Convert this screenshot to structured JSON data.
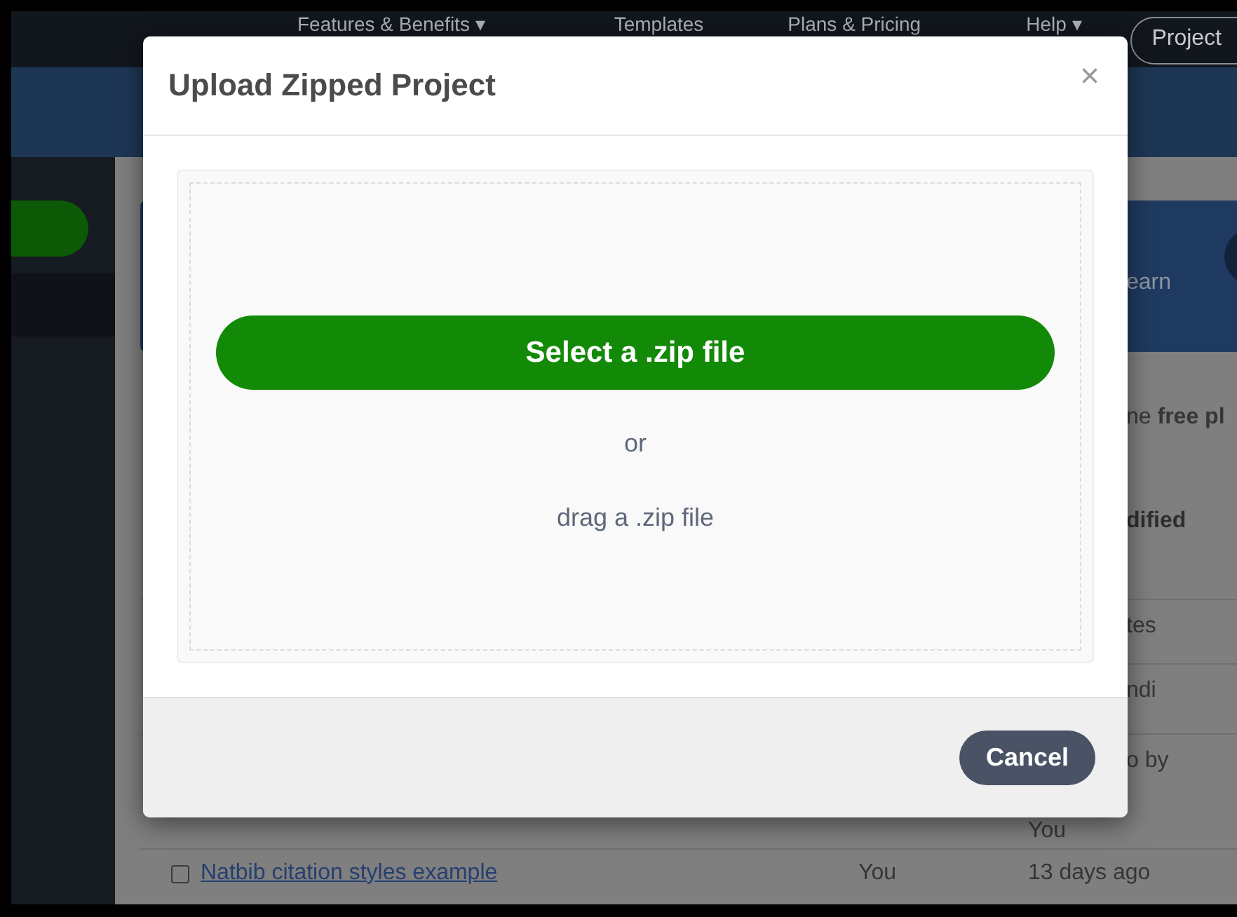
{
  "background_page": {
    "nav": {
      "items": [
        {
          "label": "Features & Benefits ▾"
        },
        {
          "label": "Templates"
        },
        {
          "label": "Plans & Pricing"
        },
        {
          "label": "Help ▾"
        }
      ],
      "account_button": "Project"
    },
    "banner": {
      "text": "earn"
    },
    "plan_notice": "ne **free pl**",
    "table": {
      "columns": [
        {
          "label": "dified"
        }
      ],
      "rows": [
        {
          "modified": [
            "tes"
          ]
        },
        {
          "modified": [
            "ndi"
          ]
        },
        {
          "modified": [
            "o by",
            "You"
          ]
        },
        {
          "name": "Natbib citation styles example",
          "owner": "You",
          "modified": [
            "13 days ago"
          ],
          "checked": false
        }
      ]
    }
  },
  "modal": {
    "title": "Upload Zipped Project",
    "close": "×",
    "select_button": "Select a .zip file",
    "separator": "or",
    "drag_hint": "drag a .zip file",
    "cancel_button": "Cancel"
  }
}
